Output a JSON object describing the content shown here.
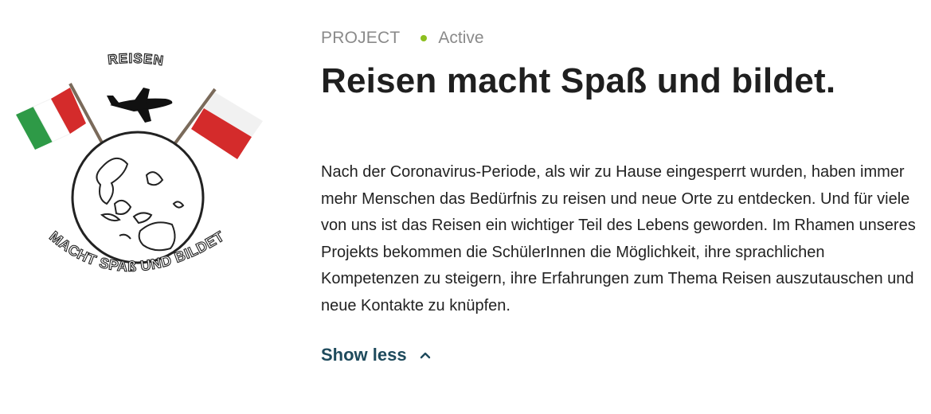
{
  "logo": {
    "top_text": "REISEN",
    "bottom_text": "MACHT SPAß UND BILDET"
  },
  "project": {
    "type_label": "PROJECT",
    "status_label": "Active",
    "status_color": "#8cbf1f",
    "title": "Reisen macht Spaß und bildet.",
    "description": "Nach der Coronavirus-Periode, als wir zu Hause eingesperrt wurden, haben immer mehr Menschen das Bedürfnis zu reisen und neue Orte zu entdecken. Und für viele von uns ist das Reisen ein wichtiger Teil des Lebens geworden. Im Rhamen unseres Projekts bekommen die SchülerInnen die Möglichkeit, ihre sprachlichen Kompetenzen zu steigern, ihre Erfahrungen zum Thema Reisen auszutauschen und neue Kontakte zu knüpfen.",
    "toggle_label": "Show less",
    "toggle_icon": "chevron-up-icon"
  },
  "colors": {
    "title": "#1f1f1f",
    "meta": "#8a8a8a",
    "link": "#1e4a5c",
    "flag_green": "#2e9a47",
    "flag_red": "#d42b2b"
  }
}
